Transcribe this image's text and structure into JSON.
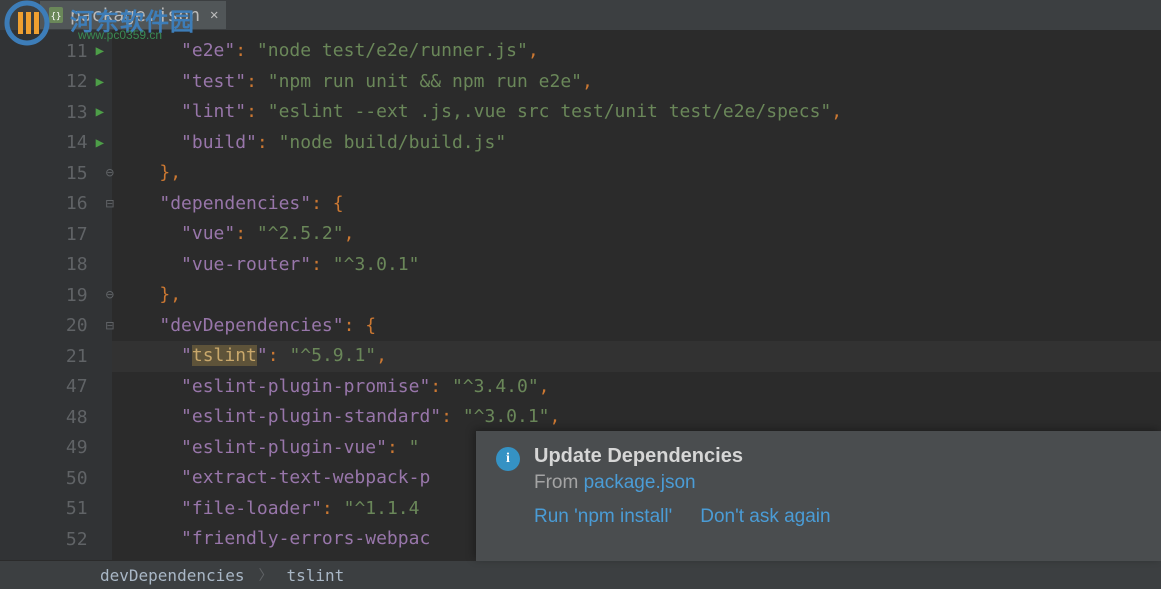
{
  "watermark": {
    "url": "www.pc0359.cn",
    "title": "河东软件园"
  },
  "tab": {
    "filename": "package.json"
  },
  "editor": {
    "lines": [
      {
        "num": "11",
        "run": true,
        "fold": "",
        "indent": "      ",
        "tokens": [
          {
            "t": "key",
            "v": "\"e2e\""
          },
          {
            "t": "punct",
            "v": ": "
          },
          {
            "t": "string",
            "v": "\"node test/e2e/runner.js\""
          },
          {
            "t": "punct",
            "v": ","
          }
        ]
      },
      {
        "num": "12",
        "run": true,
        "fold": "",
        "indent": "      ",
        "tokens": [
          {
            "t": "key",
            "v": "\"test\""
          },
          {
            "t": "punct",
            "v": ": "
          },
          {
            "t": "string",
            "v": "\"npm run unit && npm run e2e\""
          },
          {
            "t": "punct",
            "v": ","
          }
        ]
      },
      {
        "num": "13",
        "run": true,
        "fold": "",
        "indent": "      ",
        "tokens": [
          {
            "t": "key",
            "v": "\"lint\""
          },
          {
            "t": "punct",
            "v": ": "
          },
          {
            "t": "string",
            "v": "\"eslint --ext .js,.vue src test/unit test/e2e/specs\""
          },
          {
            "t": "punct",
            "v": ","
          }
        ]
      },
      {
        "num": "14",
        "run": true,
        "fold": "",
        "indent": "      ",
        "tokens": [
          {
            "t": "key",
            "v": "\"build\""
          },
          {
            "t": "punct",
            "v": ": "
          },
          {
            "t": "string",
            "v": "\"node build/build.js\""
          }
        ]
      },
      {
        "num": "15",
        "run": false,
        "fold": "⊖",
        "indent": "    ",
        "tokens": [
          {
            "t": "punct",
            "v": "},"
          }
        ]
      },
      {
        "num": "16",
        "run": false,
        "fold": "⊟",
        "indent": "    ",
        "tokens": [
          {
            "t": "key",
            "v": "\"dependencies\""
          },
          {
            "t": "punct",
            "v": ": {"
          }
        ]
      },
      {
        "num": "17",
        "run": false,
        "fold": "",
        "indent": "      ",
        "tokens": [
          {
            "t": "key",
            "v": "\"vue\""
          },
          {
            "t": "punct",
            "v": ": "
          },
          {
            "t": "string",
            "v": "\"^2.5.2\""
          },
          {
            "t": "punct",
            "v": ","
          }
        ]
      },
      {
        "num": "18",
        "run": false,
        "fold": "",
        "indent": "      ",
        "tokens": [
          {
            "t": "key",
            "v": "\"vue-router\""
          },
          {
            "t": "punct",
            "v": ": "
          },
          {
            "t": "string",
            "v": "\"^3.0.1\""
          }
        ]
      },
      {
        "num": "19",
        "run": false,
        "fold": "⊖",
        "indent": "    ",
        "tokens": [
          {
            "t": "punct",
            "v": "},"
          }
        ]
      },
      {
        "num": "20",
        "run": false,
        "fold": "⊟",
        "indent": "    ",
        "tokens": [
          {
            "t": "key",
            "v": "\"devDependencies\""
          },
          {
            "t": "punct",
            "v": ": {"
          }
        ]
      },
      {
        "num": "21",
        "run": false,
        "fold": "",
        "indent": "      ",
        "highlight": true,
        "tokens": [
          {
            "t": "key",
            "v": "\"tslint\""
          },
          {
            "t": "punct",
            "v": ": "
          },
          {
            "t": "string",
            "v": "\"^5.9.1\""
          },
          {
            "t": "punct",
            "v": ","
          }
        ]
      },
      {
        "num": "47",
        "run": false,
        "fold": "",
        "indent": "      ",
        "tokens": [
          {
            "t": "key",
            "v": "\"eslint-plugin-promise\""
          },
          {
            "t": "punct",
            "v": ": "
          },
          {
            "t": "string",
            "v": "\"^3.4.0\""
          },
          {
            "t": "punct",
            "v": ","
          }
        ]
      },
      {
        "num": "48",
        "run": false,
        "fold": "",
        "indent": "      ",
        "tokens": [
          {
            "t": "key",
            "v": "\"eslint-plugin-standard\""
          },
          {
            "t": "punct",
            "v": ": "
          },
          {
            "t": "string",
            "v": "\"^3.0.1\""
          },
          {
            "t": "punct",
            "v": ","
          }
        ]
      },
      {
        "num": "49",
        "run": false,
        "fold": "",
        "indent": "      ",
        "tokens": [
          {
            "t": "key",
            "v": "\"eslint-plugin-vue\""
          },
          {
            "t": "punct",
            "v": ": "
          },
          {
            "t": "string",
            "v": "\""
          }
        ]
      },
      {
        "num": "50",
        "run": false,
        "fold": "",
        "indent": "      ",
        "tokens": [
          {
            "t": "key",
            "v": "\"extract-text-webpack-p"
          }
        ]
      },
      {
        "num": "51",
        "run": false,
        "fold": "",
        "indent": "      ",
        "tokens": [
          {
            "t": "key",
            "v": "\"file-loader\""
          },
          {
            "t": "punct",
            "v": ": "
          },
          {
            "t": "string",
            "v": "\"^1.1.4"
          }
        ]
      },
      {
        "num": "52",
        "run": false,
        "fold": "",
        "indent": "      ",
        "tokens": [
          {
            "t": "key",
            "v": "\"friendly-errors-webpac"
          }
        ]
      }
    ]
  },
  "breadcrumb": {
    "items": [
      "devDependencies",
      "tslint"
    ]
  },
  "notification": {
    "title": "Update Dependencies",
    "from_prefix": "From ",
    "from_link": "package.json",
    "action1": "Run 'npm install'",
    "action2": "Don't ask again"
  }
}
